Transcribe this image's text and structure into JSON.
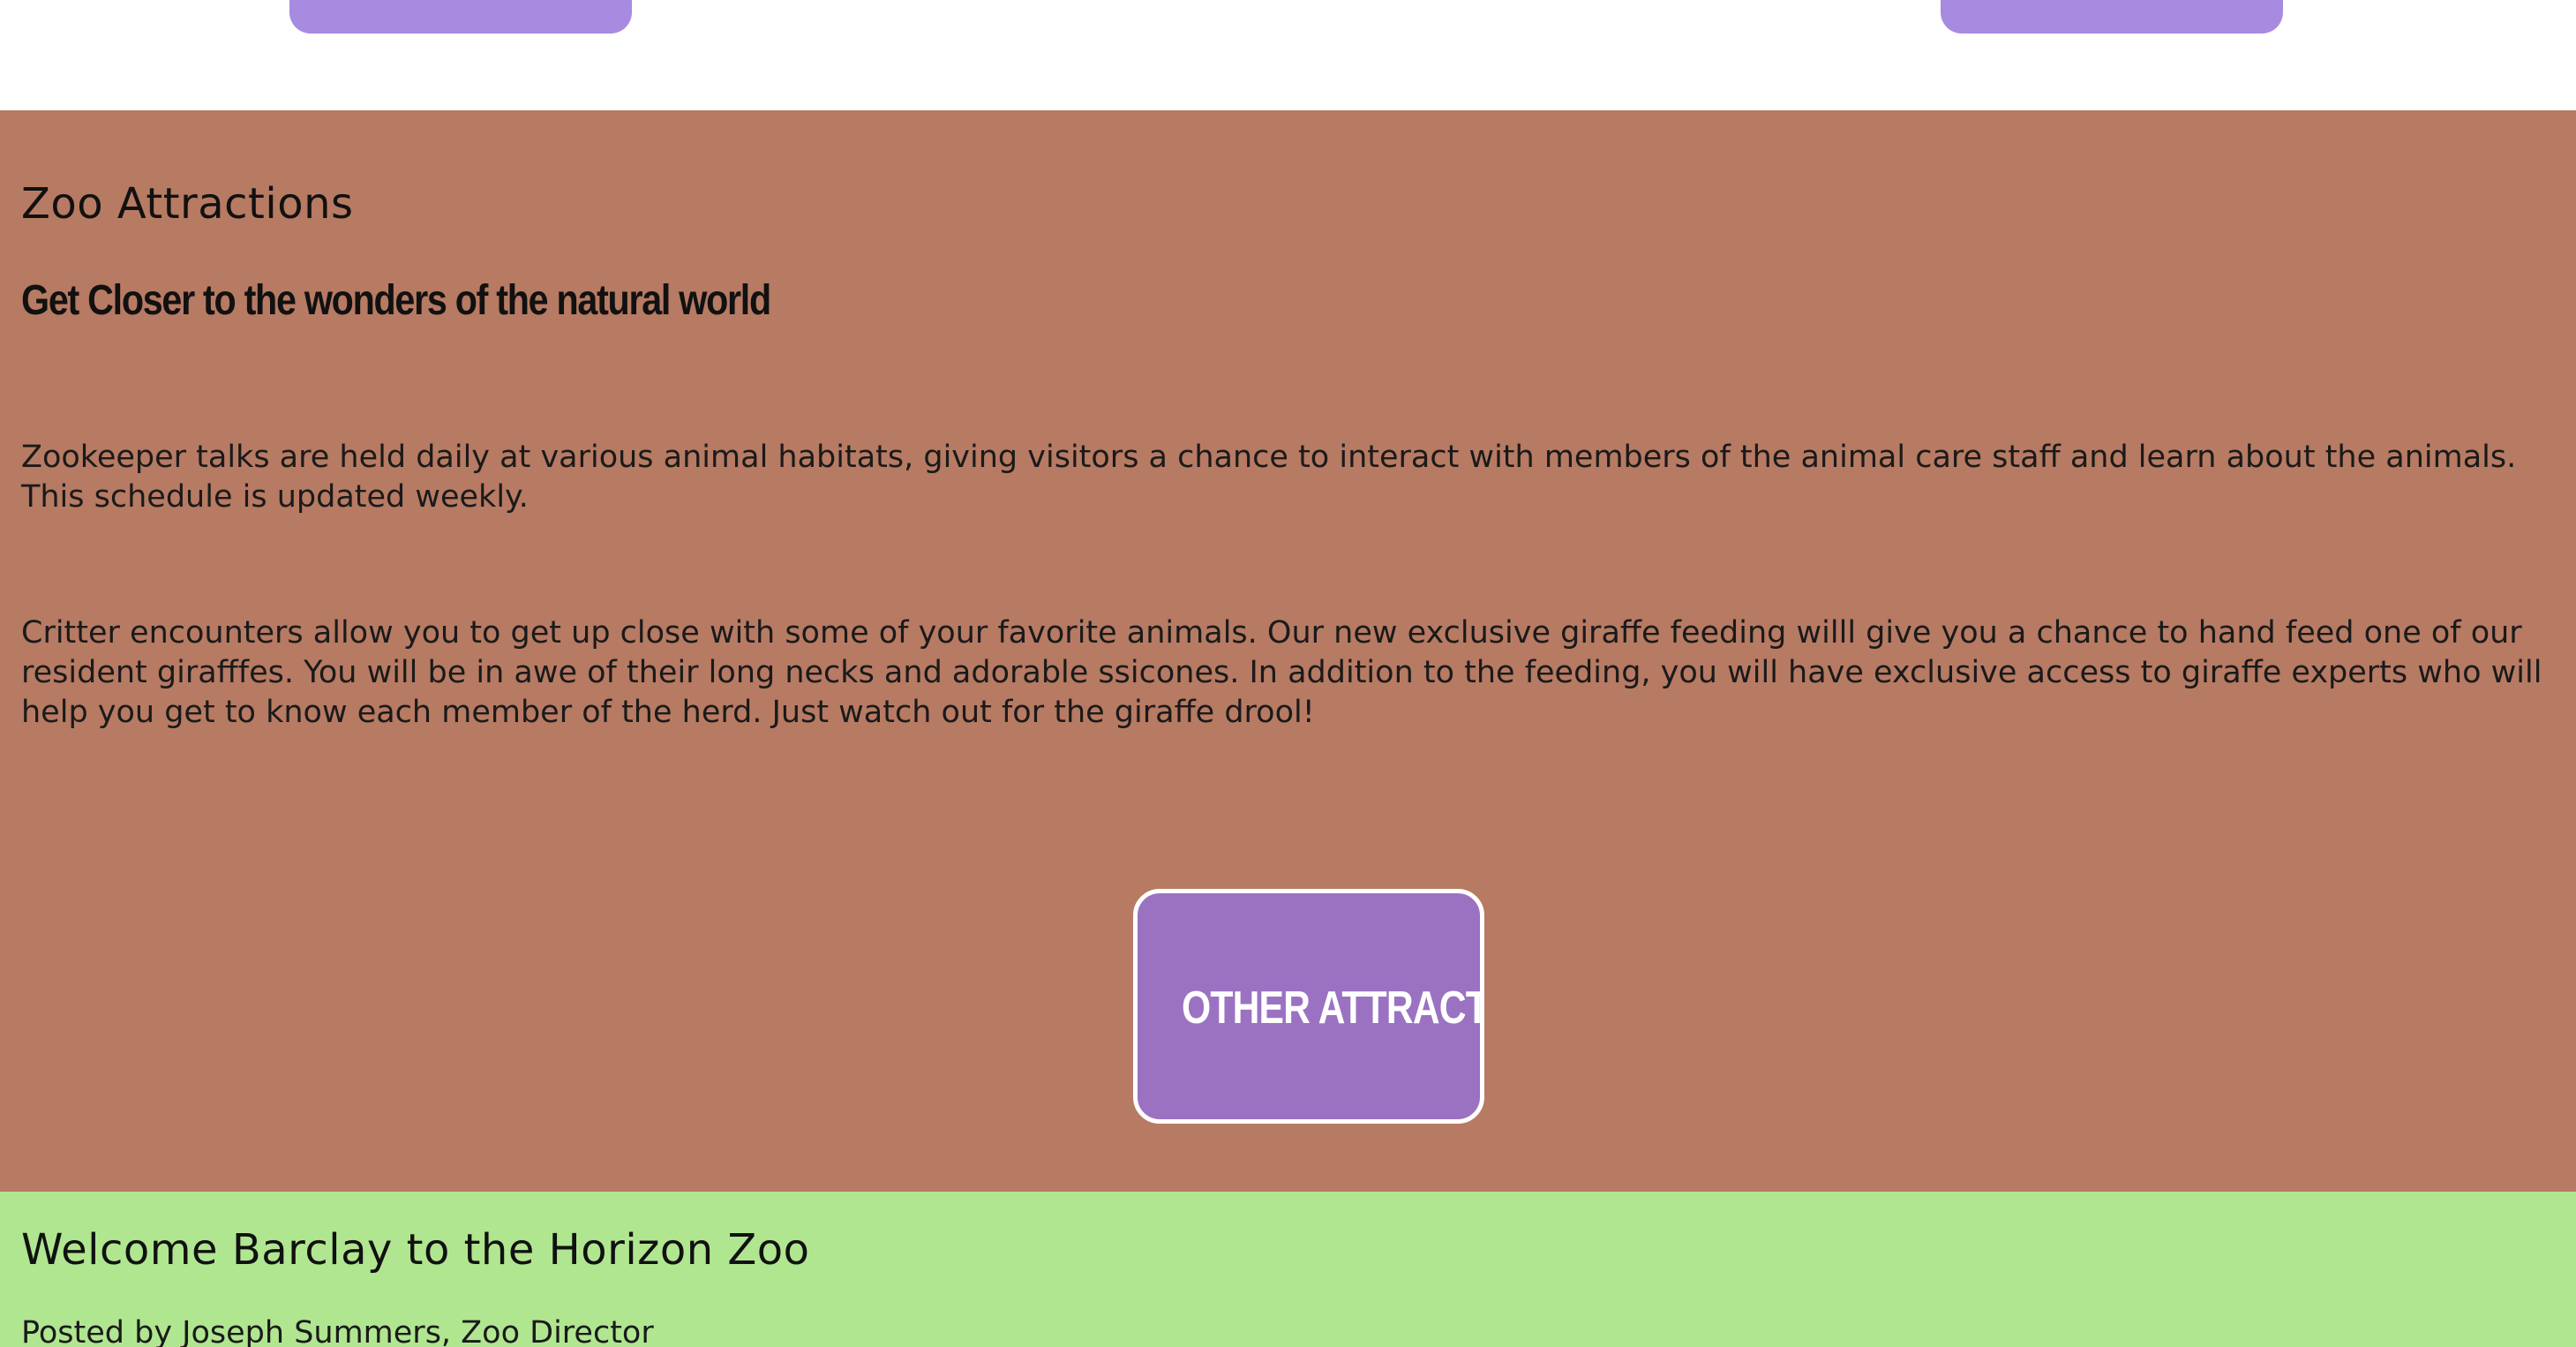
{
  "header": {
    "buttons": [
      "",
      ""
    ]
  },
  "attractions": {
    "title": "Zoo Attractions",
    "subtitle": "Get Closer to the wonders of the natural world",
    "paragraphs": [
      "Zookeeper talks are held daily at various animal habitats, giving visitors a chance to interact with members of the animal care staff and learn about the animals. This schedule is updated weekly.",
      "Critter encounters allow you to get up close with some of your favorite animals. Our new exclusive giraffe feeding willl give you a chance to hand feed one of our resident girafffes. You will be in awe of their long necks and adorable ssicones. In addition to the feeding, you will have exclusive access to giraffe experts who will help you get to know each member of the herd. Just watch out for the giraffe drool!"
    ],
    "button_label": "OTHER ATTRACTIONS"
  },
  "blog": {
    "title": "Welcome Barclay to the Horizon Zoo",
    "byline": "Posted by Joseph Summers, Zoo Director"
  },
  "colors": {
    "attractions_bg": "#b77a63",
    "button_purple": "#9b72c2",
    "top_button_purple": "#a78be0",
    "blog_bg": "#b0e690"
  }
}
